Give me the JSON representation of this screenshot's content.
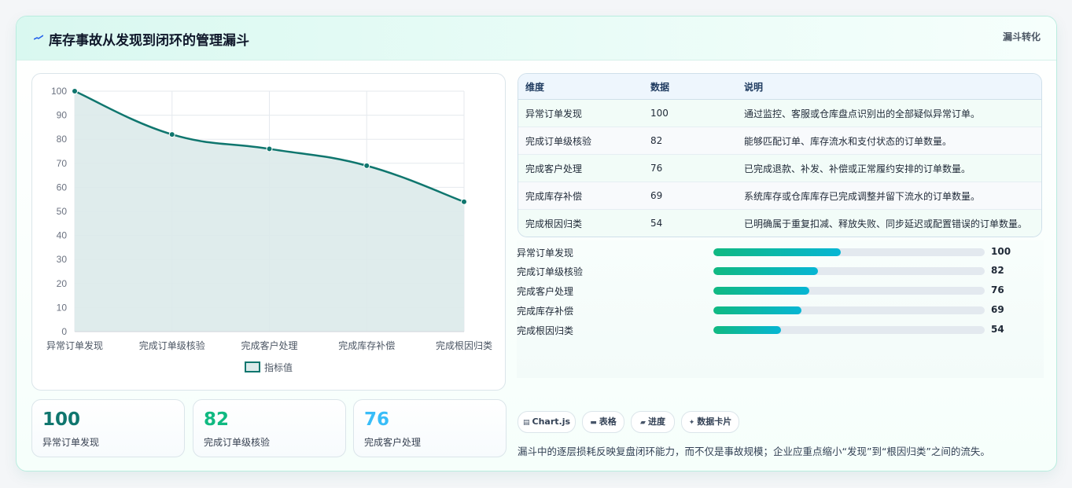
{
  "header": {
    "title": "库存事故从发现到闭环的管理漏斗",
    "tag": "漏斗转化",
    "accent": "#2563eb"
  },
  "chart_data": {
    "type": "area",
    "categories": [
      "异常订单发现",
      "完成订单级核验",
      "完成客户处理",
      "完成库存补偿",
      "完成根因归类"
    ],
    "series": [
      {
        "name": "指标值",
        "values": [
          100,
          82,
          76,
          69,
          54
        ]
      }
    ],
    "ylim": [
      0,
      100
    ],
    "yticks": [
      "0",
      "10",
      "20",
      "30",
      "40",
      "50",
      "60",
      "70",
      "80",
      "90",
      "100"
    ],
    "grid": true,
    "legend_position": "bottom",
    "line_color": "#0f766e",
    "fill_color": "#dbeaea"
  },
  "stats": [
    {
      "value": "100",
      "label": "异常订单发现",
      "color": "#0f766e"
    },
    {
      "value": "82",
      "label": "完成订单级核验",
      "color": "#10b981"
    },
    {
      "value": "76",
      "label": "完成客户处理",
      "color": "#38bdf8"
    }
  ],
  "table": {
    "headers": [
      "维度",
      "数据",
      "说明"
    ],
    "rows": [
      [
        "异常订单发现",
        "100",
        "通过监控、客服或仓库盘点识别出的全部疑似异常订单。"
      ],
      [
        "完成订单级核验",
        "82",
        "能够匹配订单、库存流水和支付状态的订单数量。"
      ],
      [
        "完成客户处理",
        "76",
        "已完成退款、补发、补偿或正常履约安排的订单数量。"
      ],
      [
        "完成库存补偿",
        "69",
        "系统库存或仓库库存已完成调整并留下流水的订单数量。"
      ],
      [
        "完成根因归类",
        "54",
        "已明确属于重复扣减、释放失败、同步延迟或配置错误的订单数量。"
      ]
    ]
  },
  "bars": [
    {
      "label": "异常订单发现",
      "value": "100",
      "fill": 0.47
    },
    {
      "label": "完成订单级核验",
      "value": "82",
      "fill": 0.385
    },
    {
      "label": "完成客户处理",
      "value": "76",
      "fill": 0.355
    },
    {
      "label": "完成库存补偿",
      "value": "69",
      "fill": 0.325
    },
    {
      "label": "完成根因归类",
      "value": "54",
      "fill": 0.25
    }
  ],
  "chips": [
    {
      "icon": "chart-icon",
      "glyph": "▤",
      "label": "Chart.js"
    },
    {
      "icon": "table-icon",
      "glyph": "▬",
      "label": "表格"
    },
    {
      "icon": "progress-icon",
      "glyph": "▰",
      "label": "进度"
    },
    {
      "icon": "card-icon",
      "glyph": "✦",
      "label": "数据卡片"
    }
  ],
  "note": "漏斗中的逐层损耗反映复盘闭环能力，而不仅是事故规模；企业应重点缩小“发现”到“根因归类”之间的流失。"
}
